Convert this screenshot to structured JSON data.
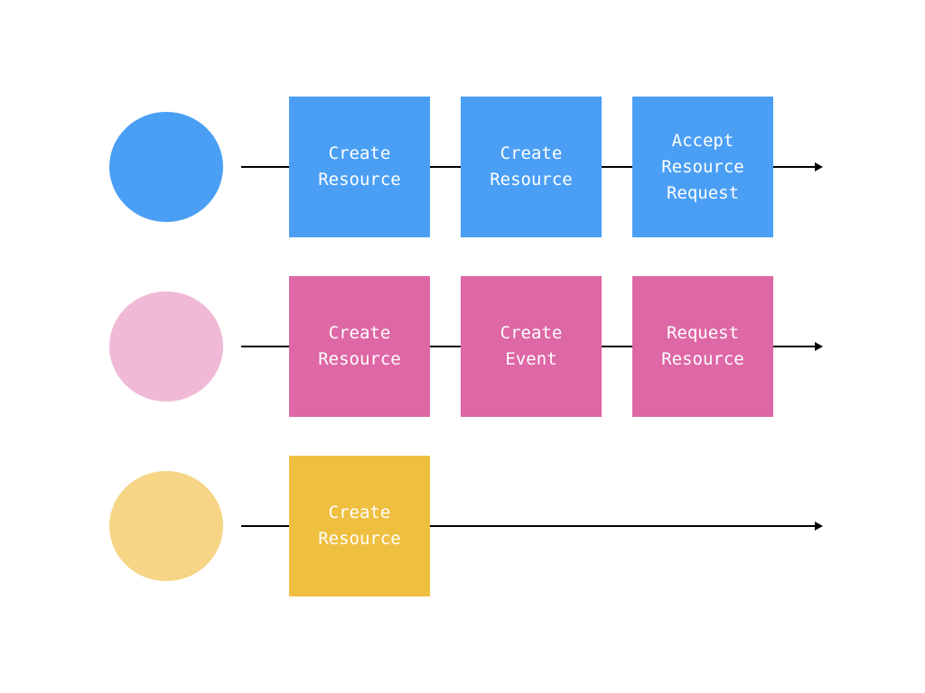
{
  "lanes": [
    {
      "circle_color": "#4a9ff5",
      "box_color": "#4a9ff5",
      "steps": [
        {
          "label": "Create\nResource"
        },
        {
          "label": "Create\nResource"
        },
        {
          "label": "Accept\nResource\nRequest"
        }
      ]
    },
    {
      "circle_color": "#f0bad6",
      "box_color": "#de67a5",
      "steps": [
        {
          "label": "Create\nResource"
        },
        {
          "label": "Create\nEvent"
        },
        {
          "label": "Request\nResource"
        }
      ]
    },
    {
      "circle_color": "#f6d587",
      "box_color": "#efbf40",
      "steps": [
        {
          "label": "Create\nResource"
        }
      ]
    }
  ]
}
